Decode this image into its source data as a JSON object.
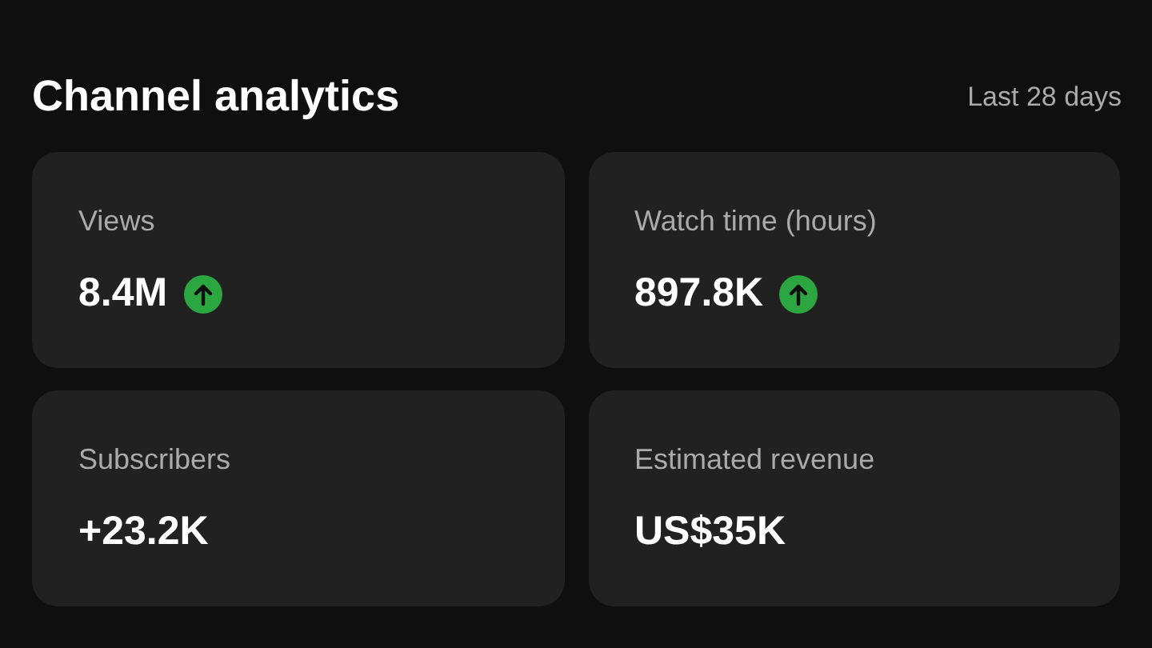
{
  "header": {
    "title": "Channel analytics",
    "period": "Last 28 days"
  },
  "cards": [
    {
      "label": "Views",
      "value": "8.4M",
      "trending_up": true
    },
    {
      "label": "Watch time (hours)",
      "value": "897.8K",
      "trending_up": true
    },
    {
      "label": "Subscribers",
      "value": "+23.2K",
      "trending_up": false
    },
    {
      "label": "Estimated revenue",
      "value": "US$35K",
      "trending_up": false
    }
  ]
}
